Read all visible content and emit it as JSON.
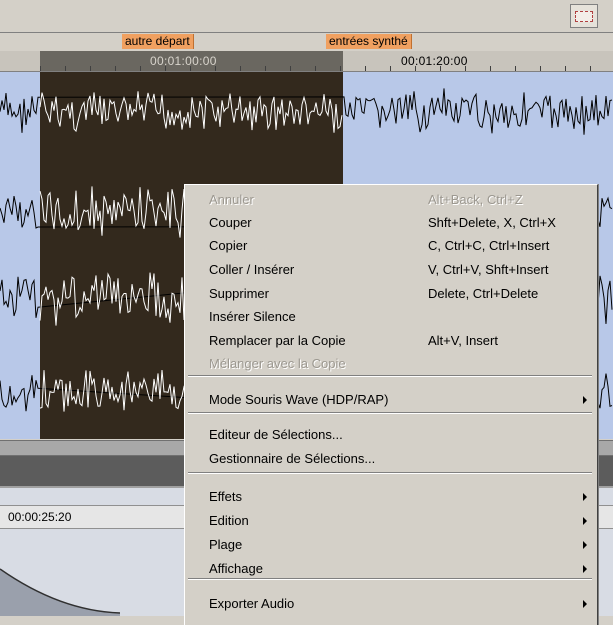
{
  "markers": [
    {
      "label": "autre départ"
    },
    {
      "label": "entrées synthé"
    }
  ],
  "ruler": {
    "times": [
      "00:01:00:00",
      "00:01:20:00"
    ]
  },
  "lower_ruler": {
    "time": "00:00:25:20"
  },
  "colors": {
    "marker_bg": "#f0a060",
    "wave_bg": "#b8c8e8",
    "selection_bg": "#33291d",
    "menu_bg": "#d4d0c8",
    "disabled_text": "#9c9890"
  },
  "context_menu": {
    "items": [
      {
        "label": "Annuler",
        "shortcut": "Alt+Back, Ctrl+Z",
        "disabled": true
      },
      {
        "label": "Couper",
        "shortcut": "Shft+Delete, X, Ctrl+X"
      },
      {
        "label": "Copier",
        "shortcut": "C, Ctrl+C, Ctrl+Insert"
      },
      {
        "label": "Coller / Insérer",
        "shortcut": "V, Ctrl+V, Shft+Insert"
      },
      {
        "label": "Supprimer",
        "shortcut": "Delete, Ctrl+Delete"
      },
      {
        "label": "Insérer Silence",
        "shortcut": ""
      },
      {
        "label": "Remplacer par la Copie",
        "shortcut": "Alt+V, Insert"
      },
      {
        "label": "Mélanger avec la Copie",
        "shortcut": "",
        "disabled": true
      },
      {
        "label": "Mode Souris Wave (HDP/RAP)",
        "submenu": true
      },
      {
        "label": "Editeur de Sélections..."
      },
      {
        "label": "Gestionnaire de Sélections..."
      },
      {
        "label": "Effets",
        "submenu": true
      },
      {
        "label": "Edition",
        "submenu": true
      },
      {
        "label": "Plage",
        "submenu": true
      },
      {
        "label": "Affichage",
        "submenu": true
      },
      {
        "label": "Exporter Audio",
        "submenu": true
      }
    ]
  }
}
